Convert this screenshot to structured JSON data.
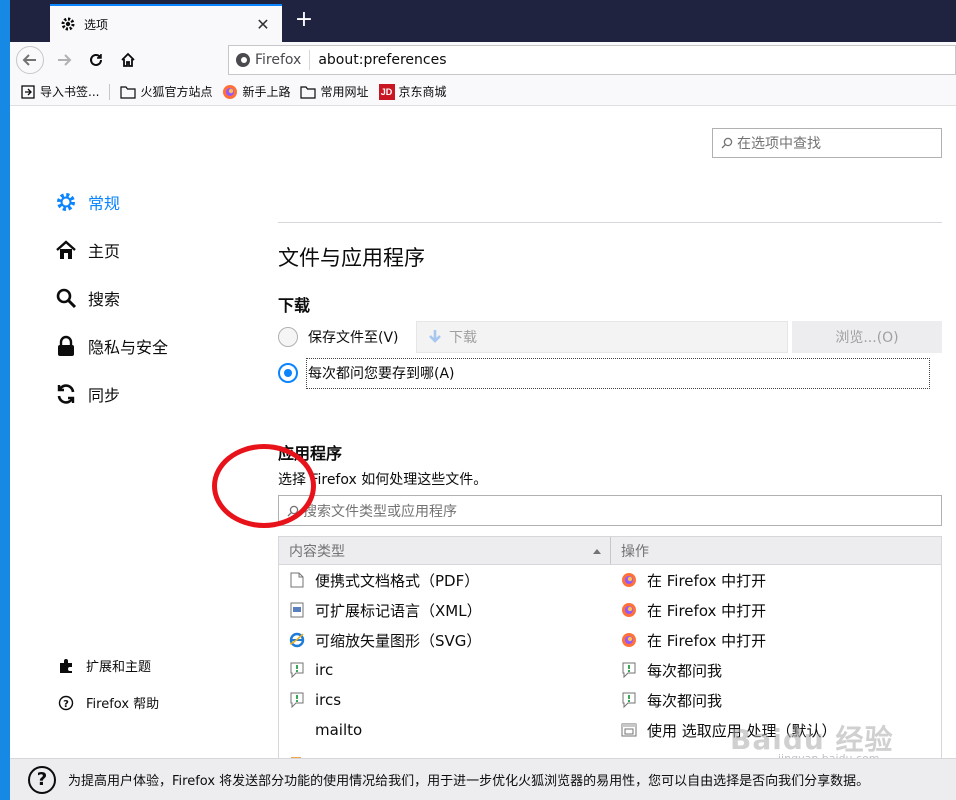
{
  "tab": {
    "title": "选项",
    "close": "✕",
    "new_tab": "+"
  },
  "urlbar": {
    "identity": "Firefox",
    "url": "about:preferences"
  },
  "bookmarks": [
    {
      "label": "导入书签...",
      "icon": "import-icon"
    },
    {
      "label": "火狐官方站点",
      "icon": "folder-icon"
    },
    {
      "label": "新手上路",
      "icon": "firefox-icon"
    },
    {
      "label": "常用网址",
      "icon": "folder-icon"
    },
    {
      "label": "京东商城",
      "icon": "jd-icon"
    }
  ],
  "search": {
    "placeholder": "在选项中查找"
  },
  "categories": [
    {
      "label": "常规",
      "icon": "gear-icon",
      "selected": true
    },
    {
      "label": "主页",
      "icon": "home-icon"
    },
    {
      "label": "搜索",
      "icon": "search-icon"
    },
    {
      "label": "隐私与安全",
      "icon": "lock-icon"
    },
    {
      "label": "同步",
      "icon": "sync-icon"
    }
  ],
  "footer_links": [
    {
      "label": "扩展和主题",
      "icon": "puzzle-icon"
    },
    {
      "label": "Firefox 帮助",
      "icon": "help-icon"
    }
  ],
  "section": {
    "title": "文件与应用程序",
    "downloads": {
      "heading": "下载",
      "save_to_label": "保存文件至(V)",
      "folder": "下载",
      "browse_label": "浏览...(O)",
      "always_ask_label": "每次都问您要存到哪(A)",
      "selected": "always_ask"
    },
    "applications": {
      "heading": "应用程序",
      "description": "选择 Firefox 如何处理这些文件。",
      "search_placeholder": "搜索文件类型或应用程序",
      "columns": {
        "type": "内容类型",
        "action": "操作"
      },
      "rows": [
        {
          "type": "便携式文档格式（PDF）",
          "type_icon": "document-icon",
          "action": "在 Firefox 中打开",
          "action_icon": "firefox-icon"
        },
        {
          "type": "可扩展标记语言（XML）",
          "type_icon": "xml-icon",
          "action": "在 Firefox 中打开",
          "action_icon": "firefox-icon"
        },
        {
          "type": "可缩放矢量图形（SVG）",
          "type_icon": "ie-icon",
          "action": "在 Firefox 中打开",
          "action_icon": "firefox-icon"
        },
        {
          "type": "irc",
          "type_icon": "chat-icon",
          "action": "每次都问我",
          "action_icon": "chat-icon"
        },
        {
          "type": "ircs",
          "type_icon": "chat-icon",
          "action": "每次都问我",
          "action_icon": "chat-icon"
        },
        {
          "type": "mailto",
          "type_icon": "",
          "action": "使用 选取应用 处理（默认）",
          "action_icon": "app-icon"
        }
      ]
    }
  },
  "notice": {
    "text": "为提高用户体验，Firefox 将发送部分功能的使用情况给我们，用于进一步优化火狐浏览器的易用性，您可以自由选择是否向我们分享数据。"
  },
  "watermark": {
    "text": "Baidu 经验",
    "sub": "jingyan.baidu.com"
  },
  "colors": {
    "accent": "#0a84ff",
    "tabstrip": "#202340",
    "annotation": "#e8131a"
  }
}
